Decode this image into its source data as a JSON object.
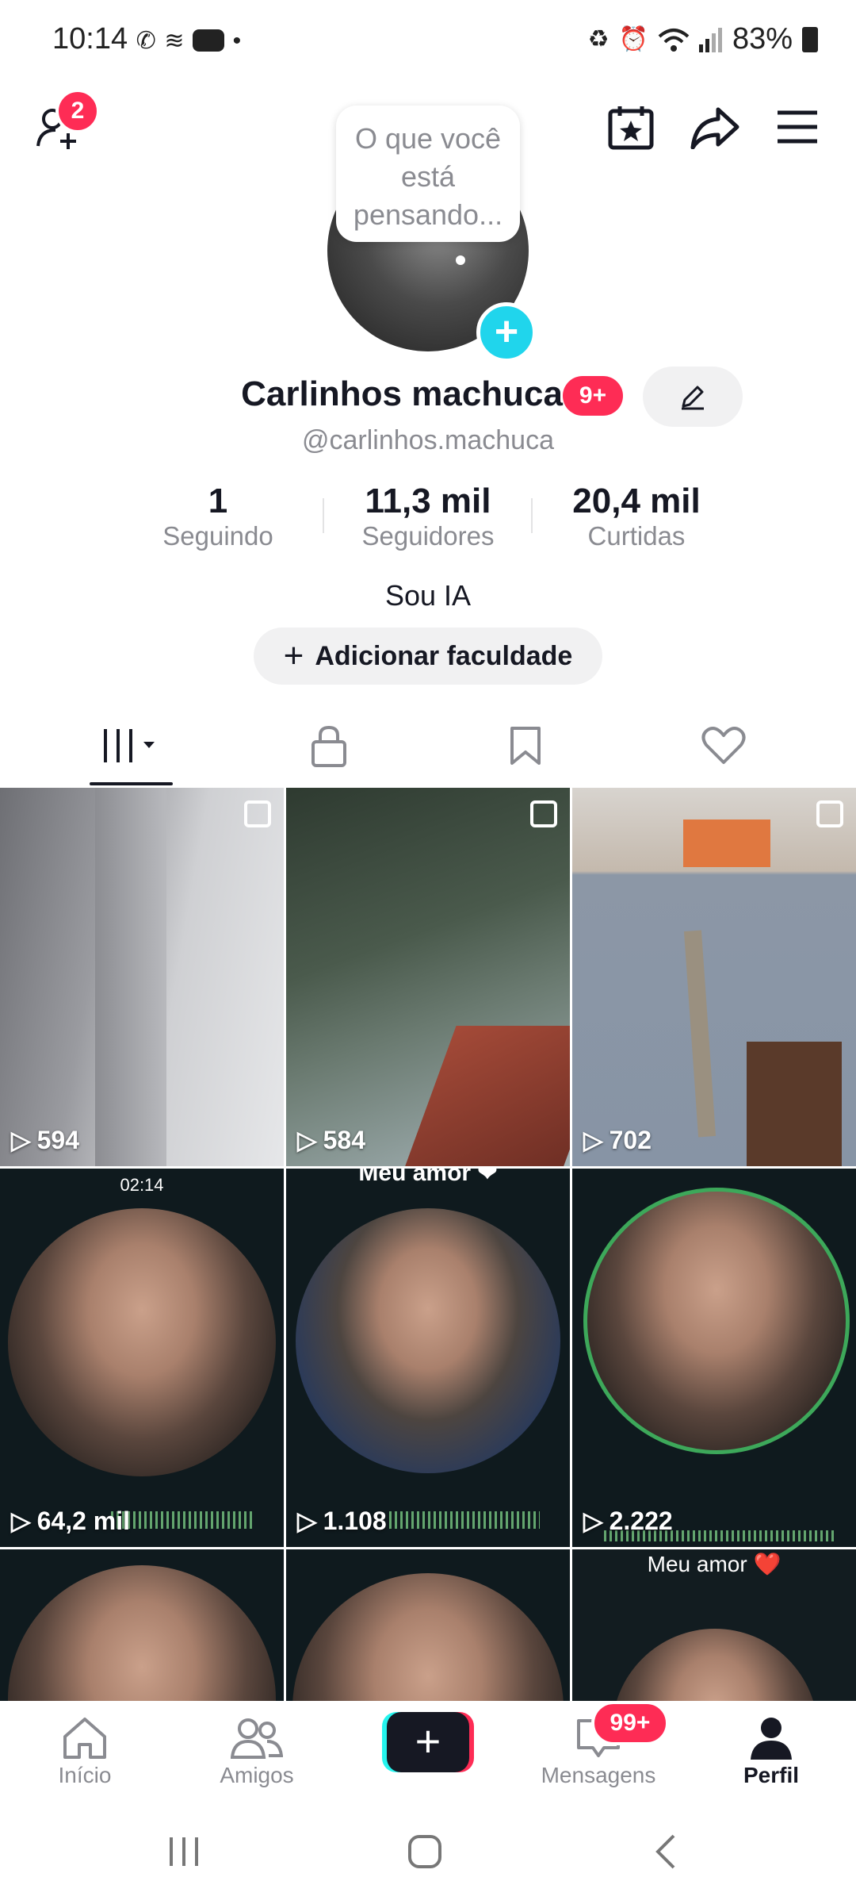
{
  "status_bar": {
    "time": "10:14",
    "battery": "83%"
  },
  "header": {
    "friend_requests_badge": "2"
  },
  "profile": {
    "thought_bubble": "O que você está pensando...",
    "name": "Carlinhos machuca",
    "name_badge": "9+",
    "handle": "@carlinhos.machuca",
    "bio": "Sou IA",
    "add_button": "Adicionar faculdade"
  },
  "stats": [
    {
      "value": "1",
      "label": "Seguindo"
    },
    {
      "value": "11,3 mil",
      "label": "Seguidores"
    },
    {
      "value": "20,4 mil",
      "label": "Curtidas"
    }
  ],
  "videos": [
    {
      "views": "594",
      "multi": true
    },
    {
      "views": "584",
      "multi": true
    },
    {
      "views": "702",
      "multi": true
    },
    {
      "views": "64,2 mil",
      "caption_top": "02:14"
    },
    {
      "views": "1.108",
      "caption_top": "Meu amor ❤"
    },
    {
      "views": "2.222"
    },
    {
      "views": ""
    },
    {
      "views": ""
    },
    {
      "views": "",
      "caption_top": "Meu amor ❤️"
    }
  ],
  "nav": {
    "home": "Início",
    "friends": "Amigos",
    "messages": "Mensagens",
    "messages_badge": "99+",
    "profile": "Perfil"
  },
  "colors": {
    "accent": "#fe2c55",
    "teal": "#20d5ec"
  }
}
